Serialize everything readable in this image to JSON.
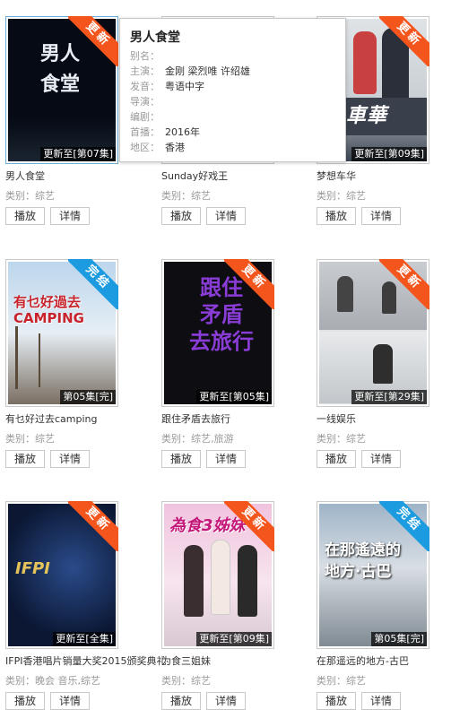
{
  "badges": {
    "updating": "更新",
    "finished": "完结"
  },
  "buttons": {
    "play": "播放",
    "detail": "详情"
  },
  "colors": {
    "badge_updating": "#f4551d",
    "badge_finished": "#1c9be0"
  },
  "popup": {
    "title": "男人食堂",
    "rows": [
      {
        "key": "别名：",
        "value": ""
      },
      {
        "key": "主演：",
        "value": "金刚  梁烈唯  许绍雄"
      },
      {
        "key": "发音：",
        "value": "粤语中字"
      },
      {
        "key": "导演：",
        "value": ""
      },
      {
        "key": "编剧：",
        "value": ""
      },
      {
        "key": "首播：",
        "value": "2016年"
      },
      {
        "key": "地区：",
        "value": "香港"
      }
    ]
  },
  "items": [
    {
      "title": "男人食堂",
      "category": "类别：综艺",
      "episode": "更新至[第07集]",
      "badge": "更新",
      "poster_text": "男人\n食堂"
    },
    {
      "title": "Sunday好戏王",
      "category": "类别：综艺",
      "episode": "",
      "badge": "",
      "poster_text": ""
    },
    {
      "title": "梦想车华",
      "category": "类别：综艺",
      "episode": "更新至[第09集]",
      "badge": "更新",
      "poster_text": "車華"
    },
    {
      "title": "有乜好过去camping",
      "category": "类别：综艺",
      "episode": "第05集[完]",
      "badge": "完结",
      "poster_text": "有乜好過去\nCAMPING"
    },
    {
      "title": "跟住矛盾去旅行",
      "category": "类别：综艺,旅游",
      "episode": "更新至[第05集]",
      "badge": "更新",
      "poster_text": "跟住\n矛盾\n去旅行"
    },
    {
      "title": "一线娱乐",
      "category": "类别：综艺",
      "episode": "更新至[第29集]",
      "badge": "更新",
      "poster_text": ""
    },
    {
      "title": "IFPI香港唱片销量大奖2015颁奖典礼",
      "category": "类别：晚会 音乐,综艺",
      "episode": "更新至[全集]",
      "badge": "更新",
      "poster_text": "IFPI"
    },
    {
      "title": "为食三姐妹",
      "category": "类别：综艺",
      "episode": "更新至[第09集]",
      "badge": "更新",
      "poster_text": "為食3姊妹"
    },
    {
      "title": "在那遥远的地方-古巴",
      "category": "类别：综艺",
      "episode": "第05集[完]",
      "badge": "完结",
      "poster_text": "在那遙遠的\n地方·古巴"
    }
  ]
}
